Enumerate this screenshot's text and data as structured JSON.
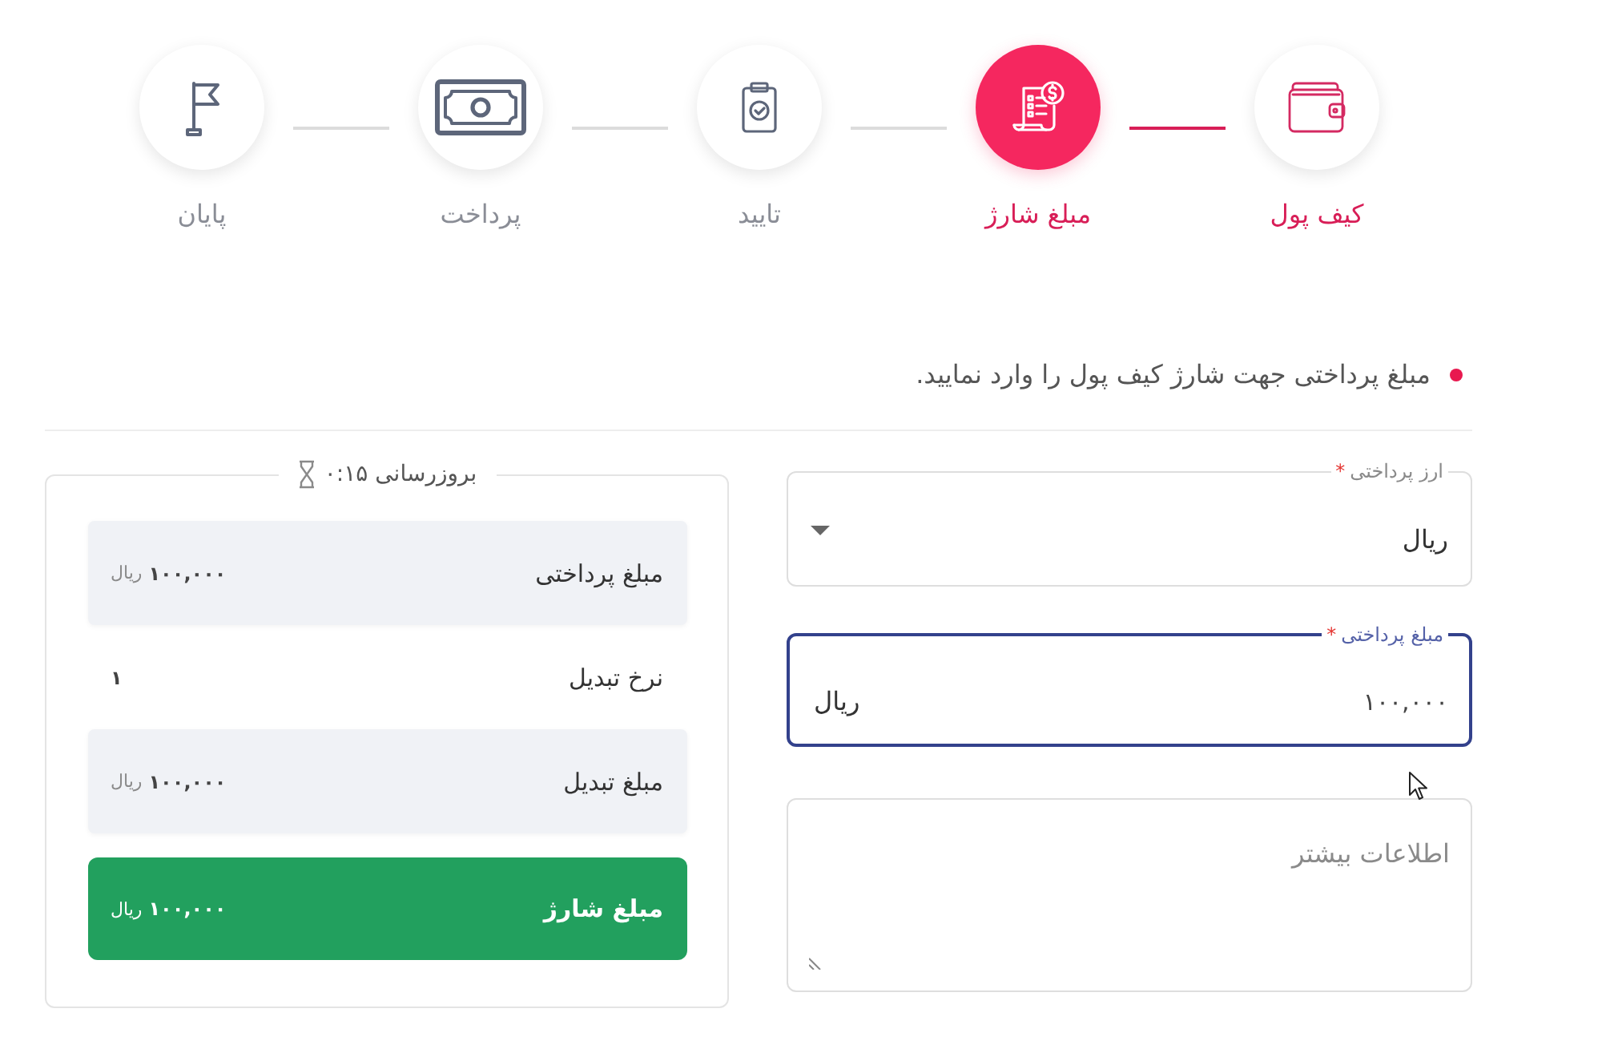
{
  "stepper": {
    "steps": [
      {
        "label": "کیف پول",
        "done": true,
        "selected": false
      },
      {
        "label": "مبلغ شارژ",
        "done": false,
        "selected": true
      },
      {
        "label": "تایید",
        "done": false,
        "selected": false
      },
      {
        "label": "پرداخت",
        "done": false,
        "selected": false
      },
      {
        "label": "پایان",
        "done": false,
        "selected": false
      }
    ]
  },
  "instruction": "مبلغ پرداختی جهت شارژ کیف پول را وارد نمایید.",
  "form": {
    "fields": [
      {
        "kind": "select",
        "label": "ارز پرداختی",
        "required_mark": "*",
        "focused": false,
        "value": "ریال"
      },
      {
        "kind": "input",
        "label": "مبلغ پرداختی",
        "required_mark": "*",
        "focused": true,
        "value": "۱۰۰,۰۰۰",
        "suffix": "ریال"
      },
      {
        "kind": "textarea",
        "placeholder": "اطلاعات بیشتر",
        "focused": false
      }
    ]
  },
  "summary": {
    "header": "بروزرسانی ۰:۱۵",
    "rows": [
      {
        "kind": "shaded",
        "label": "مبلغ پرداختی",
        "amount": "۱۰۰,۰۰۰",
        "unit": "ریال"
      },
      {
        "kind": "plain",
        "label": "نرخ تبدیل",
        "amount": "۱"
      },
      {
        "kind": "shaded",
        "label": "مبلغ تبدیل",
        "amount": "۱۰۰,۰۰۰",
        "unit": "ریال"
      },
      {
        "kind": "total",
        "label": "مبلغ شارژ",
        "amount": "۱۰۰,۰۰۰",
        "unit": "ریال"
      }
    ]
  }
}
